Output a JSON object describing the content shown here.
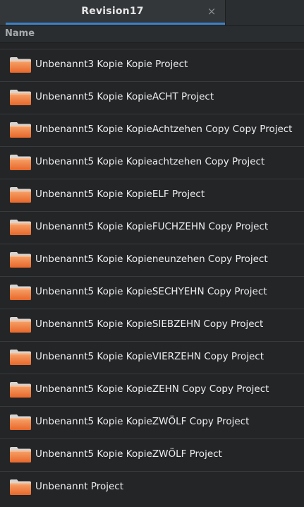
{
  "tab": {
    "title": "Revision17",
    "close_glyph": "×"
  },
  "column_header": {
    "name_label": "Name"
  },
  "icons": {
    "item_icon": "folder-icon",
    "folder_color_top": "#f7a46b",
    "folder_color_body": "#e8672a"
  },
  "colors": {
    "background": "#232527",
    "accent": "#3c80c8"
  },
  "files": [
    {
      "name": "Unbenannt3 Kopie Kopie Project"
    },
    {
      "name": "Unbenannt5 Kopie KopieACHT Project"
    },
    {
      "name": "Unbenannt5 Kopie KopieAchtzehen Copy Copy Project"
    },
    {
      "name": "Unbenannt5 Kopie Kopieachtzehen Copy Project"
    },
    {
      "name": "Unbenannt5 Kopie KopieELF Project"
    },
    {
      "name": "Unbenannt5 Kopie KopieFUCHZEHN Copy Project"
    },
    {
      "name": "Unbenannt5 Kopie Kopieneunzehen Copy Project"
    },
    {
      "name": "Unbenannt5 Kopie KopieSECHYEHN Copy Project"
    },
    {
      "name": "Unbenannt5 Kopie KopieSIEBZEHN Copy Project"
    },
    {
      "name": "Unbenannt5 Kopie KopieVIERZEHN Copy Project"
    },
    {
      "name": "Unbenannt5 Kopie KopieZEHN Copy Copy Project"
    },
    {
      "name": "Unbenannt5 Kopie KopieZWÖLF Copy Project"
    },
    {
      "name": "Unbenannt5 Kopie KopieZWÖLF Project"
    },
    {
      "name": "Unbenannt Project"
    }
  ]
}
